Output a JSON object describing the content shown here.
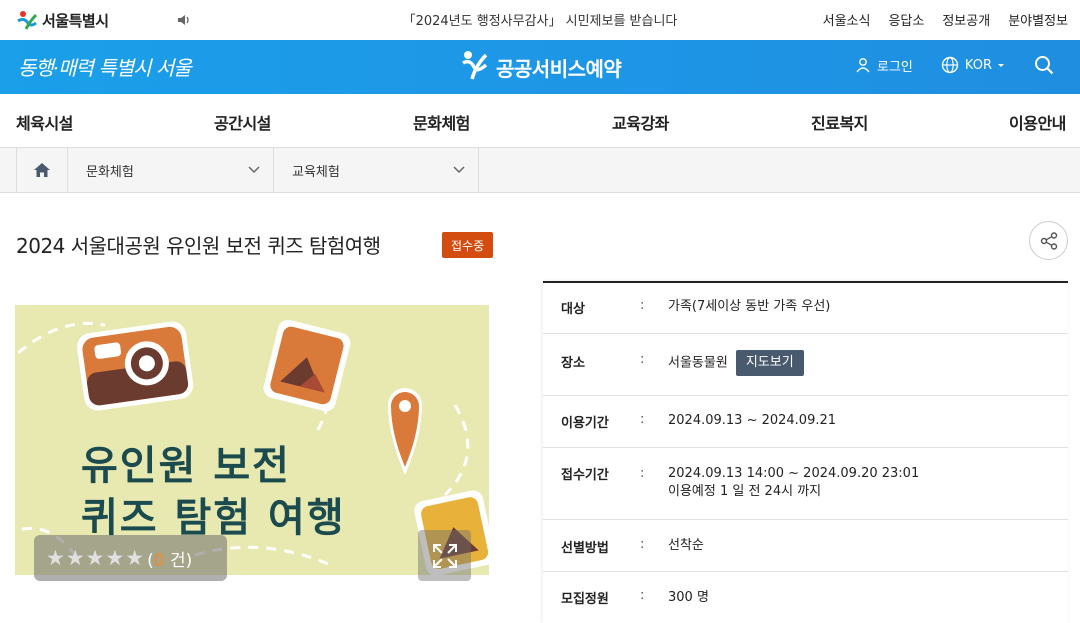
{
  "topbar": {
    "brand": "서울특별시",
    "notice": "「2024년도 행정사무감사」 시민제보를 받습니다",
    "links": [
      "서울소식",
      "응답소",
      "정보공개",
      "분야별정보"
    ]
  },
  "header": {
    "slogan": "동행·매력 특별시 서울",
    "service_title": "공공서비스예약",
    "login": "로그인",
    "language": "KOR",
    "colors": {
      "primary": "#1e95e6"
    }
  },
  "gnb": [
    "체육시설",
    "공간시설",
    "문화체험",
    "교육강좌",
    "진료복지",
    "이용안내"
  ],
  "breadcrumb": {
    "level1": "문화체험",
    "level2": "교육체험"
  },
  "page": {
    "title": "2024 서울대공원 유인원 보전 퀴즈 탐험여행",
    "status_badge": "접수중",
    "status_color": "#d34d10"
  },
  "poster": {
    "line1": "유인원 보전",
    "line2": "퀴즈 탐험 여행",
    "stars": "★★★★★",
    "rating_open": "(",
    "rating_count": "0",
    "rating_close": " 건)"
  },
  "info": {
    "rows": [
      {
        "label": "대상",
        "value": "가족(7세이상 동반 가족 우선)"
      },
      {
        "label": "장소",
        "value": "서울동물원",
        "button": "지도보기"
      },
      {
        "label": "이용기간",
        "value": "2024.09.13 ~ 2024.09.21"
      },
      {
        "label": "접수기간",
        "value": "2024.09.13 14:00 ~ 2024.09.20 23:01",
        "value2": "이용예정 1 일 전 24시 까지"
      },
      {
        "label": "선별방법",
        "value": "선착순"
      },
      {
        "label": "모집정원",
        "value": "300 명"
      }
    ]
  }
}
